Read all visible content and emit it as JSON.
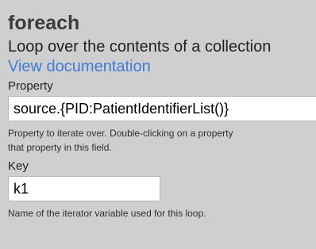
{
  "task": {
    "title": "foreach",
    "description": "Loop over the contents of a collection",
    "doc_link": "View documentation"
  },
  "fields": {
    "property": {
      "label": "Property",
      "value": "source.{PID:PatientIdentifierList()}",
      "help_line1": "Property to iterate over. Double-clicking on a property",
      "help_line2": "that property in this field."
    },
    "key": {
      "label": "Key",
      "value": "k1",
      "help": "Name of the iterator variable used for this loop."
    }
  },
  "colors": {
    "background": "#cfcfcf",
    "link": "#3f7ad6",
    "title": "#3b3b3b"
  }
}
